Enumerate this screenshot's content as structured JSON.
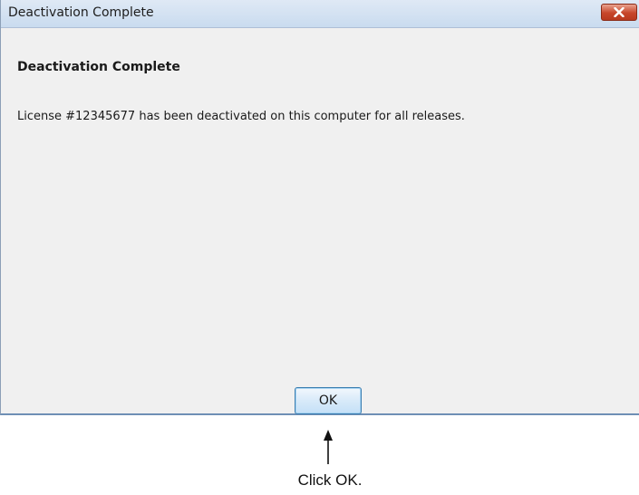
{
  "window": {
    "title": "Deactivation Complete"
  },
  "content": {
    "heading": "Deactivation Complete",
    "message": "License #12345677 has been deactivated on this computer for all releases."
  },
  "buttons": {
    "ok_label": "OK"
  },
  "annotation": {
    "callout_text": "Click OK."
  },
  "colors": {
    "close_button": "#c7462a",
    "dialog_background": "#f0f0f0",
    "ok_button_border": "#3c7fb1"
  }
}
